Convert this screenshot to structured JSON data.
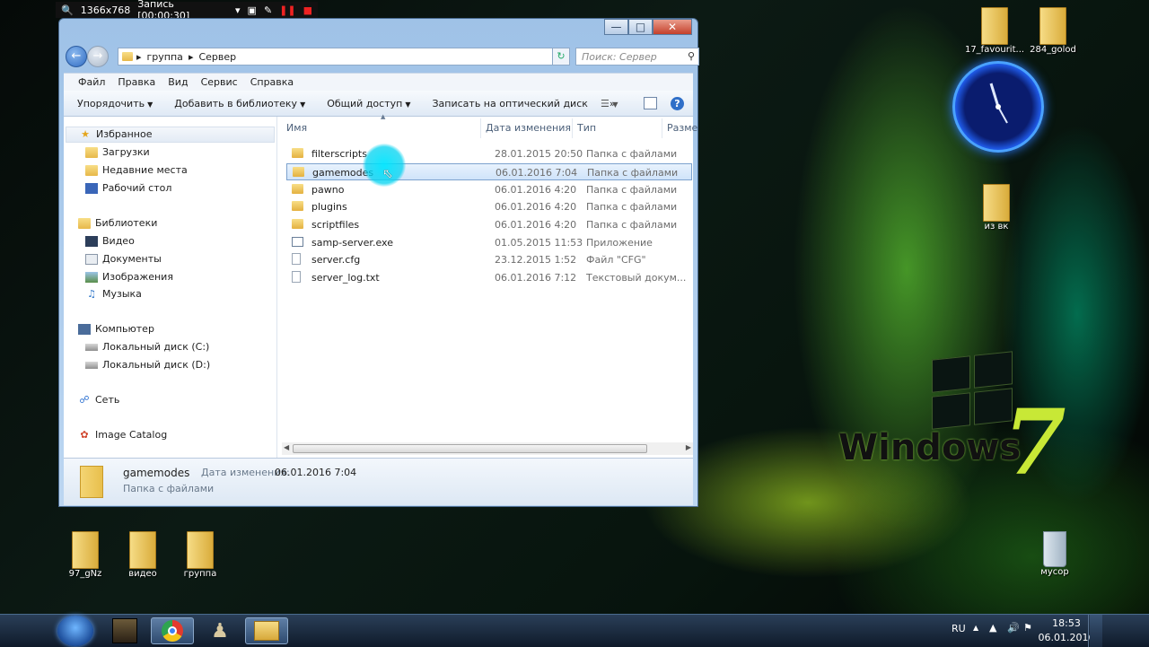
{
  "recorder": {
    "resolution": "1366x768",
    "status": "Запись [00:00:30]"
  },
  "window": {
    "breadcrumb": [
      "группа",
      "Сервер"
    ],
    "search_placeholder": "Поиск: Сервер",
    "menu": [
      "Файл",
      "Правка",
      "Вид",
      "Сервис",
      "Справка"
    ],
    "toolbar": [
      "Упорядочить",
      "Добавить в библиотеку",
      "Общий доступ",
      "Записать на оптический диск"
    ],
    "toolbar_more": "»",
    "nav": {
      "favorites": {
        "label": "Избранное",
        "items": [
          "Загрузки",
          "Недавние места",
          "Рабочий стол"
        ]
      },
      "libraries": {
        "label": "Библиотеки",
        "items": [
          "Видео",
          "Документы",
          "Изображения",
          "Музыка"
        ]
      },
      "computer": {
        "label": "Компьютер",
        "items": [
          "Локальный диск (C:)",
          "Локальный диск (D:)"
        ]
      },
      "network": {
        "label": "Сеть"
      },
      "catalog": {
        "label": "Image Catalog"
      }
    },
    "columns": {
      "name": "Имя",
      "date": "Дата изменения",
      "type": "Тип",
      "size": "Разме"
    },
    "files": [
      {
        "name": "filterscripts",
        "date": "28.01.2015 20:50",
        "type": "Папка с файлами",
        "kind": "folder"
      },
      {
        "name": "gamemodes",
        "date": "06.01.2016 7:04",
        "type": "Папка с файлами",
        "kind": "folder"
      },
      {
        "name": "pawno",
        "date": "06.01.2016 4:20",
        "type": "Папка с файлами",
        "kind": "folder"
      },
      {
        "name": "plugins",
        "date": "06.01.2016 4:20",
        "type": "Папка с файлами",
        "kind": "folder"
      },
      {
        "name": "scriptfiles",
        "date": "06.01.2016 4:20",
        "type": "Папка с файлами",
        "kind": "folder"
      },
      {
        "name": "samp-server.exe",
        "date": "01.05.2015 11:53",
        "type": "Приложение",
        "kind": "exe"
      },
      {
        "name": "server.cfg",
        "date": "23.12.2015 1:52",
        "type": "Файл \"CFG\"",
        "kind": "doc"
      },
      {
        "name": "server_log.txt",
        "date": "06.01.2016 7:12",
        "type": "Текстовый докум...",
        "kind": "doc"
      }
    ],
    "details": {
      "name": "gamemodes",
      "date_label": "Дата изменения:",
      "date": "06.01.2016 7:04",
      "type": "Папка с файлами"
    }
  },
  "desktop": {
    "top_icons": [
      "17_favourit...",
      "284_golod"
    ],
    "mid_icon": "из вк",
    "bottom_icons": [
      "97_gNz",
      "видео",
      "группа"
    ],
    "trash": "мусор",
    "logo_text": "Windows",
    "logo_number": "7"
  },
  "taskbar": {
    "lang": "RU",
    "time": "18:53",
    "date": "06.01.2016"
  },
  "colors": {
    "selection": "#cfe3fa",
    "accent": "#00e0ff",
    "taskbar": "#1a2a40"
  }
}
